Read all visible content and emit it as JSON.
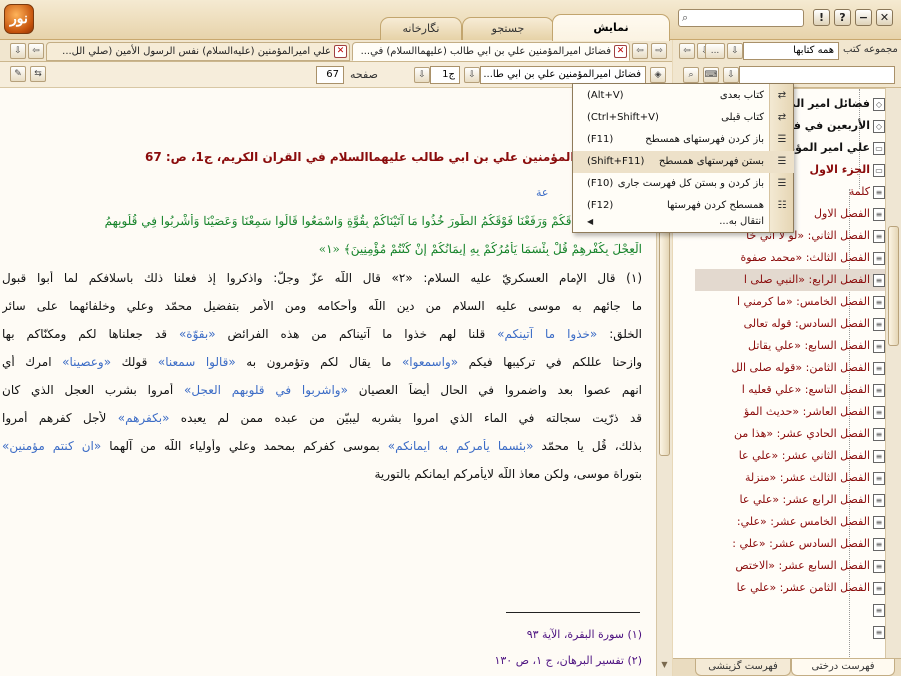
{
  "app": {
    "logo_text": "نور"
  },
  "tabs": [
    {
      "label": "نمایش"
    },
    {
      "label": "جستجو"
    },
    {
      "label": "نگارخانه"
    }
  ],
  "window_buttons": {
    "close": "✕",
    "help": "?",
    "info": "!"
  },
  "top_search": {
    "placeholder": "",
    "value": ""
  },
  "doc_tabs": [
    {
      "label": "فضائل اميرالمؤمنين علي بن ابي طالب (عليهماالسلام) في..."
    },
    {
      "label": "علي اميرالمؤمنين (عليه‌السلام) نفس الرسول الأمين (صلي الل..."
    }
  ],
  "nav": {
    "book_field": "فضائل اميرالمؤمنين علي بن ابي طا...",
    "volume_label": "ج",
    "volume_value": "1",
    "page_label": "صفحه",
    "page_value": "67"
  },
  "tree_top": {
    "collection_label": "مجموعه کتب",
    "collection_value": "همه کتابها",
    "more_label": "..."
  },
  "document": {
    "reference": "فضائل اميرالمؤمنين علي بن ابي طالب عليهماالسلام في القران الكريم، ج1، ص: 67",
    "blue_snippet": "عة",
    "quran_line1": "﴿وَإِذْ أَخَذْنَا مِيثَاقَكُمْ وَرَفَعْنَا فَوْقَكُمُ الطُّورَ خُذُوا مَا آتَيْنَاكُمْ بِقُوَّةٍ وَاسْمَعُوا قَالُوا سَمِعْنَا وَعَصَيْنَا وَأُشْرِبُوا فِي قُلُوبِهِمُ",
    "quran_line2": "الْعِجْلَ بِكُفْرِهِمْ قُلْ بِئْسَمَا يَأْمُرُكُمْ بِهِ إِيمَانُكُمْ إِنْ كُنْتُمْ مُؤْمِنِينَ﴾ «١»",
    "line1": "(١) قال الإمام العسكريّ عليه السلام: «٢» قال اللّه عزّ وجلّ: واذكروا إذ فعلنا ذلك باسلافكم لما أبوا قبول",
    "line2": "ما جائهم به موسى عليه السلام من دين اللّه وأحكامه ومن الأمر بتفضيل محمّد وعلي وخلفائهما على سائر",
    "line3_a": "الخلق: ",
    "line3_hl": "«خذوا ما آتينكم»",
    "line3_b": " قلنا لهم خذوا ما آتيناكم من هذه الفرائض ",
    "line3_hl2": "«بقوّة»",
    "line3_c": " قد جعلناها لكم ومكنّاكم بها",
    "line4_a": "وازحنا عللكم في تركيبها فيكم ",
    "line4_hl": "«واسمعوا»",
    "line4_b": " ما يقال لكم وتؤمرون به ",
    "line4_hl2": "«قالوا سمعنا»",
    "line4_c": " قولك ",
    "line4_hl3": "«وعصينا»",
    "line4_d": " امرك أي",
    "line5_a": "انهم عصوا بعد واضمروا في الحال أيضاً العصيان ",
    "line5_hl": "«واشربوا في قلوبهم العجل»",
    "line5_b": " أمروا بشرب العجل الذي كان",
    "line6_a": "قد ذرّيت سجالته في الماء الذي امروا بشربه ليبيّن من عبده ممن لم يعبده ",
    "line6_hl": "«بكفرهم»",
    "line6_b": " لأجل كفرهم أمروا",
    "line7_a": "بذلك، قُل يا محمّد ",
    "line7_hl": "«بئسما يأمركم به ايمانكم»",
    "line7_b": " بموسى كفركم بمحمد وعلي وأولياء اللّه من آلهما ",
    "line7_hl2": "«ان كنتم مؤمنين»",
    "line8": "بتوراة موسى، ولكن معاذ اللّه لايأمركم ايمانكم بالتورية",
    "footnote1": "(١) سورة البقرة، الآية ٩٣",
    "footnote2": "(٢) تفسير البرهان، ج ١، ص ١٣٠"
  },
  "context_menu": {
    "items": [
      {
        "label": "کتاب بعدی",
        "shortcut": "(Alt+V)",
        "icon": "next-book-icon"
      },
      {
        "label": "کتاب قبلی",
        "shortcut": "(Ctrl+Shift+V)",
        "icon": "previous-book-icon"
      },
      {
        "label": "باز کردن فهرستهای همسطح",
        "shortcut": "(F11)",
        "icon": "expand-siblings-icon"
      },
      {
        "label": "بستن فهرستهای همسطح",
        "shortcut": "(Shift+F11)",
        "icon": "collapse-siblings-icon"
      },
      {
        "label": "باز کردن و بستن کل فهرست جاری",
        "shortcut": "(F10)",
        "icon": "toggle-tree-icon"
      },
      {
        "label": "همسطح کردن فهرستها",
        "shortcut": "(F12)",
        "icon": "flatten-tree-icon"
      },
      {
        "label": "انتقال به...",
        "shortcut": "",
        "icon": ""
      }
    ]
  },
  "tree": {
    "items": [
      {
        "label": "فضائل امير المؤمنين",
        "kind": "book"
      },
      {
        "label": "الأربعين في فضائل",
        "kind": "book"
      },
      {
        "label": "علي امير المؤمنين",
        "kind": "book"
      },
      {
        "label": "الجزء الاول",
        "kind": "chap"
      },
      {
        "label": "كلمة",
        "kind": "sec"
      },
      {
        "label": "الفصل الاول",
        "kind": "sec"
      },
      {
        "label": "الفصل الثاني: «لو لا أني خا",
        "kind": "sec"
      },
      {
        "label": "الفصل الثالث: «محمد صفوة",
        "kind": "sec"
      },
      {
        "label": "الفصل الرابع: «النبي صلى ا",
        "kind": "sel"
      },
      {
        "label": "الفصل الخامس: «ما كرمني ا",
        "kind": "sec"
      },
      {
        "label": "الفصل السادس: قوله تعالى",
        "kind": "sec"
      },
      {
        "label": "الفصل السابع: «علي يقاتل",
        "kind": "sec"
      },
      {
        "label": "الفصل الثامن: «قوله صلى الل",
        "kind": "sec"
      },
      {
        "label": "الفصل التاسع: «علي قعليه ا",
        "kind": "sec"
      },
      {
        "label": "الفصل العاشر: «حديث المؤ",
        "kind": "sec"
      },
      {
        "label": "الفصل الحادي عشر: «هذا من",
        "kind": "sec"
      },
      {
        "label": "الفصل الثاني عشر: «علي عا",
        "kind": "sec"
      },
      {
        "label": "الفصل الثالث عشر: «منزلة",
        "kind": "sec"
      },
      {
        "label": "الفصل الرابع عشر: «علي عا",
        "kind": "sec"
      },
      {
        "label": "الفصل الخامس عشر: «علي:",
        "kind": "sec"
      },
      {
        "label": "الفصل السادس عشر: «علي :",
        "kind": "sec"
      },
      {
        "label": "الفصل السابع عشر: «الاختص",
        "kind": "sec"
      },
      {
        "label": "الفصل الثامن عشر: «علي عا",
        "kind": "sec"
      }
    ]
  },
  "bottom_tabs": [
    {
      "label": "فهرست درختی"
    },
    {
      "label": "فهرست گزینشی"
    }
  ]
}
